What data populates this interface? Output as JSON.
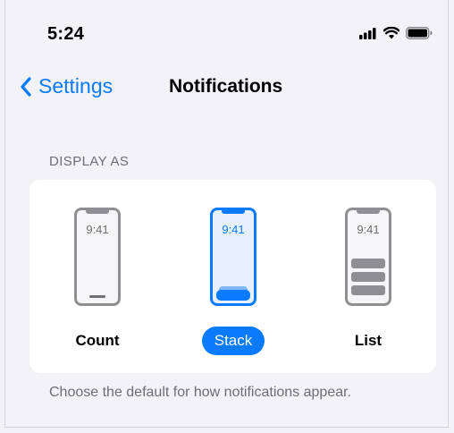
{
  "status_bar": {
    "time": "5:24",
    "icons": [
      "cellular-signal-icon",
      "wifi-icon",
      "battery-icon"
    ]
  },
  "nav": {
    "back_label": "Settings",
    "title": "Notifications"
  },
  "section": {
    "header": "DISPLAY AS",
    "options": [
      {
        "label": "Count",
        "preview_time": "9:41",
        "selected": false
      },
      {
        "label": "Stack",
        "preview_time": "9:41",
        "selected": true
      },
      {
        "label": "List",
        "preview_time": "9:41",
        "selected": false
      }
    ],
    "footer": "Choose the default for how notifications appear."
  },
  "colors": {
    "accent": "#0a7aff",
    "background": "#f2f2f7",
    "card": "#ffffff",
    "secondary_text": "#6d6d72"
  }
}
